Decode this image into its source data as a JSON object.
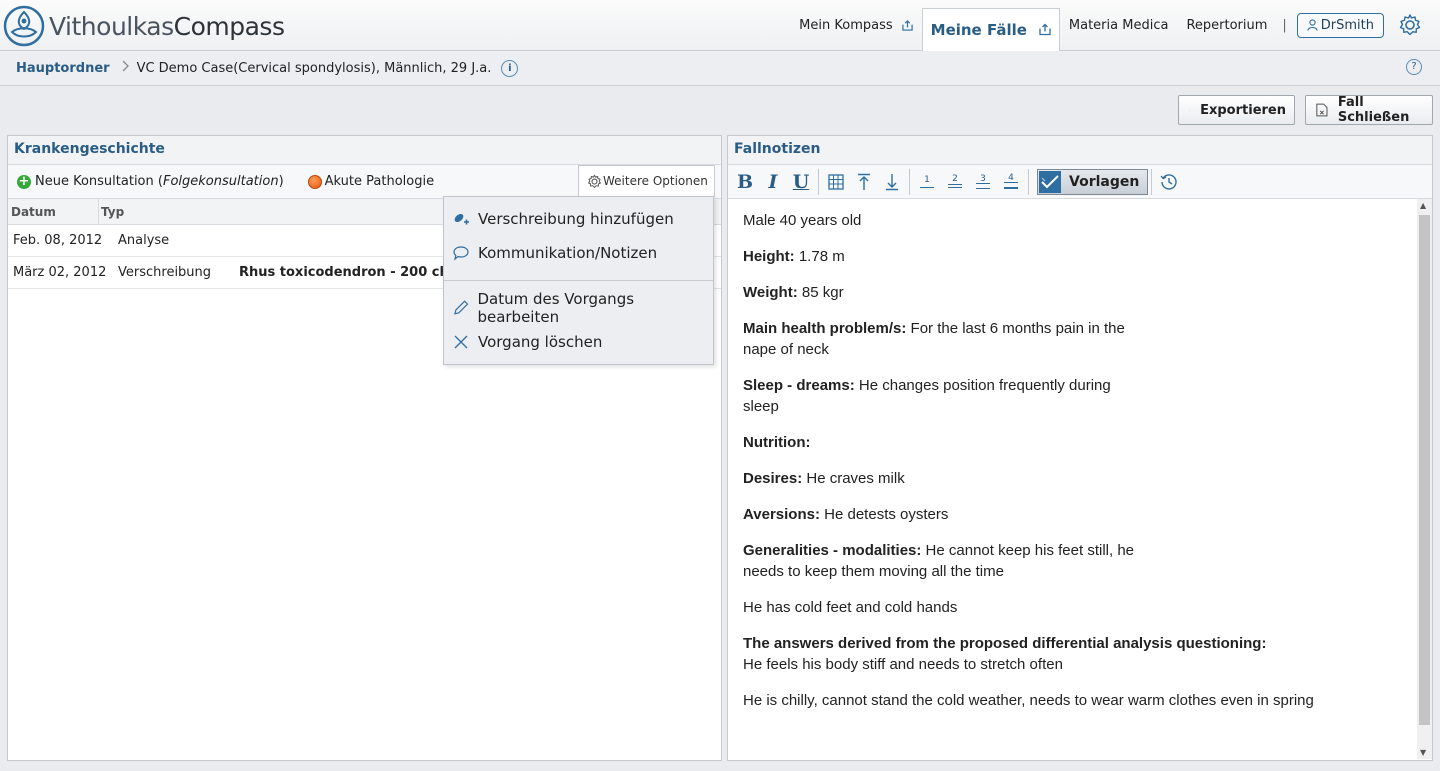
{
  "header": {
    "logo_light": "Vithoulkas",
    "logo_bold": "Compass",
    "nav": [
      {
        "label": "Mein Kompass",
        "icon": "share-icon"
      },
      {
        "label": "Meine Fälle",
        "icon": "share-icon",
        "active": true
      },
      {
        "label": "Materia Medica"
      },
      {
        "label": "Repertorium"
      }
    ],
    "separator": "|",
    "user": "DrSmith"
  },
  "breadcrumb": {
    "root": "Hauptordner",
    "case": "VC Demo Case(Cervical spondylosis), Männlich, 29 J.a.",
    "info": "i",
    "help": "?"
  },
  "actions": {
    "export": "Exportieren",
    "close_case": "Fall Schließen"
  },
  "history": {
    "title": "Krankengeschichte",
    "new_consult": "Neue Konsultation (",
    "new_consult_italic": "Folgekonsultation",
    "new_consult_end": ")",
    "acute": "Akute Pathologie",
    "more": "Weitere Optionen",
    "columns": [
      "Datum",
      "Typ"
    ],
    "rows": [
      {
        "date": "Feb. 08, 2012",
        "type": "Analyse",
        "detail": ""
      },
      {
        "date": "März 02, 2012",
        "type": "Verschreibung",
        "detail": "Rhus toxicodendron - 200 ch (1c"
      }
    ]
  },
  "menu": {
    "items": [
      "Verschreibung hinzufügen",
      "Kommunikation/Notizen",
      "Datum des Vorgangs bearbeiten",
      "Vorgang löschen"
    ]
  },
  "notes": {
    "title": "Fallnotizen",
    "toolbar": {
      "bold": "B",
      "italic": "I",
      "underline": "U",
      "h1": "1",
      "h2": "2",
      "h3": "3",
      "h4": "4",
      "templates": "Vorlagen"
    },
    "lines": [
      {
        "label": "",
        "text": "Male 40 years old"
      },
      {
        "label": "Height:",
        "text": " 1.78 m"
      },
      {
        "label": "Weight:",
        "text": " 85 kgr"
      },
      {
        "label": "Main health problem/s:",
        "text": " For the last 6 months pain in the",
        "text2": "nape of neck"
      },
      {
        "label": "Sleep - dreams:",
        "text": " He changes position frequently during",
        "text2": "sleep"
      },
      {
        "label": "Nutrition:",
        "text": ""
      },
      {
        "label": "Desires:",
        "text": " He craves milk"
      },
      {
        "label": "Aversions:",
        "text": " He detests oysters"
      },
      {
        "label": "Generalities - modalities:",
        "text": " He cannot keep his feet still, he",
        "text2": "needs to keep them moving all the time"
      },
      {
        "label": "",
        "text": "He has cold feet and cold hands"
      },
      {
        "label": "The answers derived from the proposed differential analysis questioning:",
        "text": "",
        "text2": "He feels his body stiff and needs to stretch often"
      },
      {
        "label": "",
        "text": "He is chilly, cannot stand the cold weather, needs to wear warm clothes even in spring"
      }
    ]
  }
}
